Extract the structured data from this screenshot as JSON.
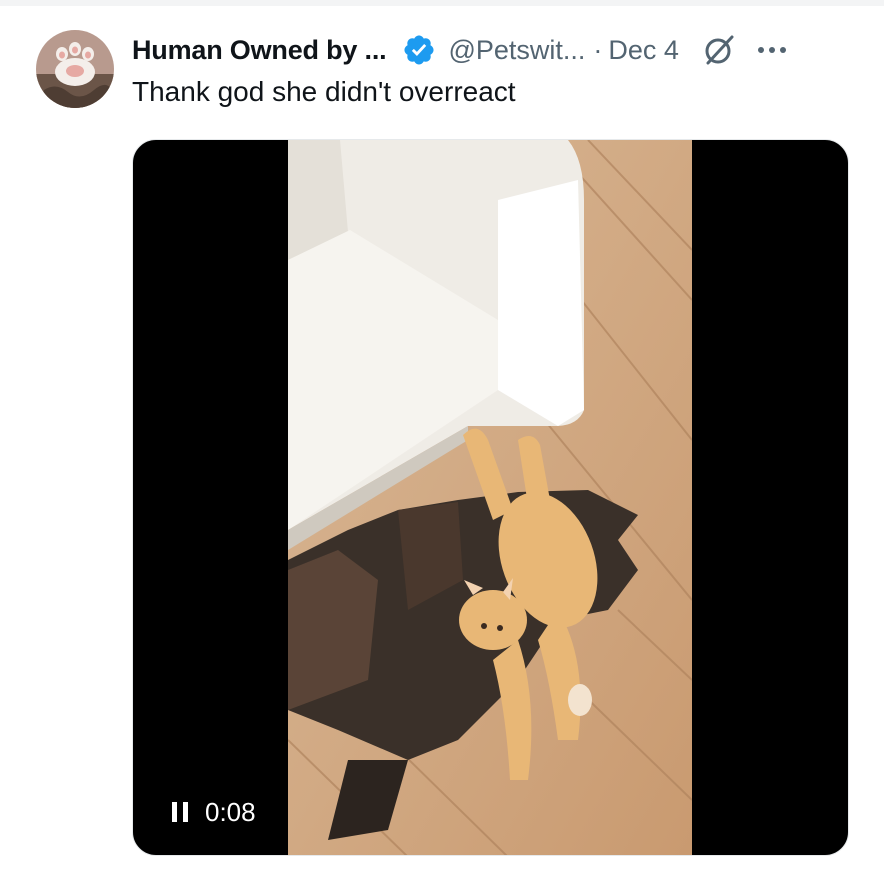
{
  "tweet": {
    "author_name": "Human Owned by ...",
    "handle": "@Petswit...",
    "separator": "·",
    "date": "Dec 4",
    "text": "Thank god she didn't overreact",
    "avatar_icon": "cat-paw-avatar",
    "verified_icon": "verified-badge-icon",
    "grok_icon": "grok-icon",
    "more_icon": "more-options-icon",
    "verified_color": "#1d9bf0"
  },
  "video": {
    "timestamp": "0:08",
    "state_icon": "pause-icon",
    "frame_description_icon": "cat-falling-into-floor-hole-illusion"
  }
}
